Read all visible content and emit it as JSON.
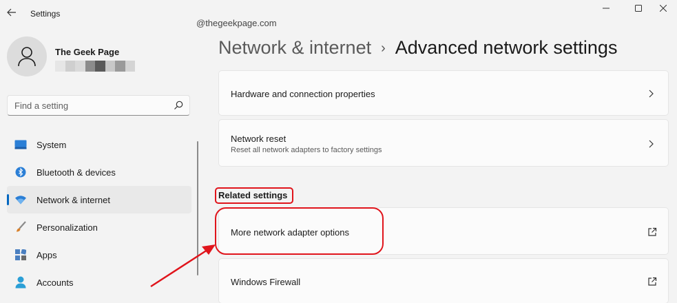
{
  "window": {
    "app_title": "Settings",
    "controls": {
      "minimize": "minimize",
      "maximize": "maximize",
      "close": "close"
    }
  },
  "watermark": "@thegeekpage.com",
  "user": {
    "name": "The Geek Page",
    "email_redacted": true
  },
  "search": {
    "placeholder": "Find a setting"
  },
  "nav": {
    "items": [
      {
        "label": "System",
        "icon": "monitor-icon",
        "active": false
      },
      {
        "label": "Bluetooth & devices",
        "icon": "bluetooth-icon",
        "active": false
      },
      {
        "label": "Network & internet",
        "icon": "wifi-icon",
        "active": true
      },
      {
        "label": "Personalization",
        "icon": "paintbrush-icon",
        "active": false
      },
      {
        "label": "Apps",
        "icon": "apps-icon",
        "active": false
      },
      {
        "label": "Accounts",
        "icon": "person-icon",
        "active": false
      }
    ]
  },
  "breadcrumb": {
    "parent": "Network & internet",
    "separator": "›",
    "current": "Advanced network settings"
  },
  "cards": {
    "hardware": {
      "title": "Hardware and connection properties"
    },
    "reset": {
      "title": "Network reset",
      "subtitle": "Reset all network adapters to factory settings"
    }
  },
  "related": {
    "header": "Related settings",
    "items": [
      {
        "title": "More network adapter options",
        "icon": "open-external-icon"
      },
      {
        "title": "Windows Firewall",
        "icon": "open-external-icon"
      }
    ]
  },
  "colors": {
    "accent": "#0067c0",
    "annotation": "#e0141b",
    "background": "#f3f3f3",
    "card": "#fbfbfb"
  }
}
